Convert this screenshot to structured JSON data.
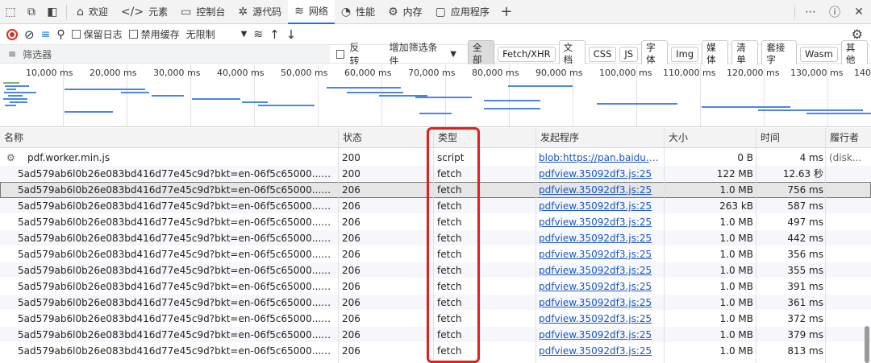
{
  "tabs": [
    {
      "icon": "home-icon",
      "glyph": "⌂",
      "label": "欢迎",
      "active": false
    },
    {
      "icon": "code-icon",
      "glyph": "</>",
      "label": "元素",
      "active": false
    },
    {
      "icon": "console-icon",
      "glyph": "▭",
      "label": "控制台",
      "active": false
    },
    {
      "icon": "bug-icon",
      "glyph": "✲",
      "label": "源代码",
      "active": false
    },
    {
      "icon": "wifi-icon",
      "glyph": "≋",
      "label": "网络",
      "active": true
    },
    {
      "icon": "performance-icon",
      "glyph": "◔",
      "label": "性能",
      "active": false
    },
    {
      "icon": "memory-icon",
      "glyph": "⚙",
      "label": "内存",
      "active": false
    },
    {
      "icon": "application-icon",
      "glyph": "▢",
      "label": "应用程序",
      "active": false
    }
  ],
  "toolbar": {
    "preserve_log": "保留日志",
    "disable_cache": "禁用缓存",
    "throttle": "无限制"
  },
  "filter": {
    "placeholder": "筛选器",
    "invert": "反转",
    "more_filters": "增加筛选条件",
    "types": [
      "全部",
      "Fetch/XHR",
      "文档",
      "CSS",
      "JS",
      "字体",
      "Img",
      "媒体",
      "清单",
      "套接字",
      "Wasm",
      "其他"
    ],
    "selected": "全部"
  },
  "overview": {
    "ticks": [
      "10,000 ms",
      "20,000 ms",
      "30,000 ms",
      "40,000 ms",
      "50,000 ms",
      "60,000 ms",
      "70,000 ms",
      "80,000 ms",
      "90,000 ms",
      "100,000 ms",
      "110,000 ms",
      "120,000 ms",
      "130,000 ms",
      "140,0"
    ]
  },
  "table": {
    "columns": [
      "名称",
      "状态",
      "类型",
      "发起程序",
      "大小",
      "时间",
      "履行者"
    ],
    "rows": [
      {
        "name": "pdf.worker.min.js",
        "status": "200",
        "type": "script",
        "initiator": "blob:https://pan.baidu.co...",
        "size": "0 B",
        "time": "4 ms",
        "fulfilled": "(disk..."
      },
      {
        "name": "5ad579ab6l0b26e083bd416d77e45c9d?bkt=en-06f5c65000...mis&fsli...",
        "status": "200",
        "type": "fetch",
        "initiator": "pdfview.35092df3.js:25",
        "size": "122 MB",
        "time": "12.63 秒",
        "fulfilled": ""
      },
      {
        "name": "5ad579ab6l0b26e083bd416d77e45c9d?bkt=en-06f5c65000...f&use=1...",
        "status": "206",
        "type": "fetch",
        "initiator": "pdfview.35092df3.js:25",
        "size": "1.0 MB",
        "time": "756 ms",
        "fulfilled": ""
      },
      {
        "name": "5ad579ab6l0b26e083bd416d77e45c9d?bkt=en-06f5c65000...f&use=1...",
        "status": "206",
        "type": "fetch",
        "initiator": "pdfview.35092df3.js:25",
        "size": "263 kB",
        "time": "587 ms",
        "fulfilled": ""
      },
      {
        "name": "5ad579ab6l0b26e083bd416d77e45c9d?bkt=en-06f5c65000...f&use=1...",
        "status": "206",
        "type": "fetch",
        "initiator": "pdfview.35092df3.js:25",
        "size": "1.0 MB",
        "time": "497 ms",
        "fulfilled": ""
      },
      {
        "name": "5ad579ab6l0b26e083bd416d77e45c9d?bkt=en-06f5c65000...f&use=1...",
        "status": "206",
        "type": "fetch",
        "initiator": "pdfview.35092df3.js:25",
        "size": "1.0 MB",
        "time": "442 ms",
        "fulfilled": ""
      },
      {
        "name": "5ad579ab6l0b26e083bd416d77e45c9d?bkt=en-06f5c65000...f&use=1...",
        "status": "206",
        "type": "fetch",
        "initiator": "pdfview.35092df3.js:25",
        "size": "1.0 MB",
        "time": "356 ms",
        "fulfilled": ""
      },
      {
        "name": "5ad579ab6l0b26e083bd416d77e45c9d?bkt=en-06f5c65000...f&use=1...",
        "status": "206",
        "type": "fetch",
        "initiator": "pdfview.35092df3.js:25",
        "size": "1.0 MB",
        "time": "355 ms",
        "fulfilled": ""
      },
      {
        "name": "5ad579ab6l0b26e083bd416d77e45c9d?bkt=en-06f5c65000...f&use=1...",
        "status": "206",
        "type": "fetch",
        "initiator": "pdfview.35092df3.js:25",
        "size": "1.0 MB",
        "time": "391 ms",
        "fulfilled": ""
      },
      {
        "name": "5ad579ab6l0b26e083bd416d77e45c9d?bkt=en-06f5c65000...f&use=1...",
        "status": "206",
        "type": "fetch",
        "initiator": "pdfview.35092df3.js:25",
        "size": "1.0 MB",
        "time": "361 ms",
        "fulfilled": ""
      },
      {
        "name": "5ad579ab6l0b26e083bd416d77e45c9d?bkt=en-06f5c65000...f&use=1...",
        "status": "206",
        "type": "fetch",
        "initiator": "pdfview.35092df3.js:25",
        "size": "1.0 MB",
        "time": "372 ms",
        "fulfilled": ""
      },
      {
        "name": "5ad579ab6l0b26e083bd416d77e45c9d?bkt=en-06f5c65000...f&use=1...",
        "status": "206",
        "type": "fetch",
        "initiator": "pdfview.35092df3.js:25",
        "size": "1.0 MB",
        "time": "379 ms",
        "fulfilled": ""
      },
      {
        "name": "5ad579ab6l0b26e083bd416d77e45c9d?bkt=en-06f5c65000...f&use=1...",
        "status": "206",
        "type": "fetch",
        "initiator": "pdfview.35092df3.js:25",
        "size": "1.0 MB",
        "time": "813 ms",
        "fulfilled": ""
      }
    ],
    "selected_row": 2
  },
  "colors": {
    "highlight_box": "#e41e1e",
    "link": "#1a55c8",
    "active_tab": "#1a73e8"
  }
}
